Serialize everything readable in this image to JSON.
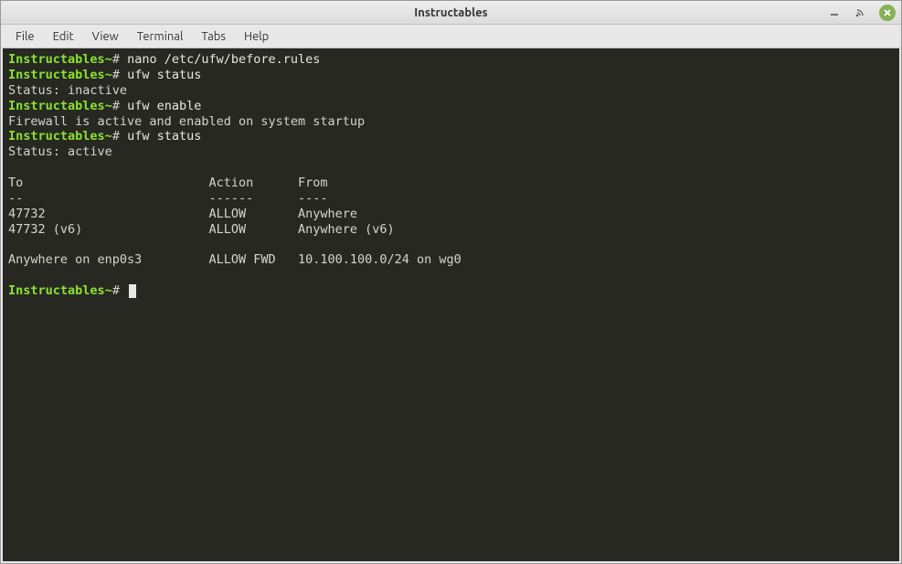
{
  "window": {
    "title": "Instructables"
  },
  "menubar": {
    "file": "File",
    "edit": "Edit",
    "view": "View",
    "terminal": "Terminal",
    "tabs": "Tabs",
    "help": "Help"
  },
  "terminal": {
    "host": "Instructables",
    "tilde": "~",
    "hash": "#",
    "commands": {
      "nano": "nano /etc/ufw/before.rules",
      "status1": "ufw status",
      "enable": "ufw enable",
      "status2": "ufw status"
    },
    "output": {
      "inactive": "Status: inactive",
      "enabled": "Firewall is active and enabled on system startup",
      "active": "Status: active",
      "header": "To                         Action      From",
      "divider": "--                         ------      ----",
      "rule1": "47732                      ALLOW       Anywhere",
      "rule2": "47732 (v6)                 ALLOW       Anywhere (v6)",
      "rule3": "Anywhere on enp0s3         ALLOW FWD   10.100.100.0/24 on wg0"
    }
  }
}
